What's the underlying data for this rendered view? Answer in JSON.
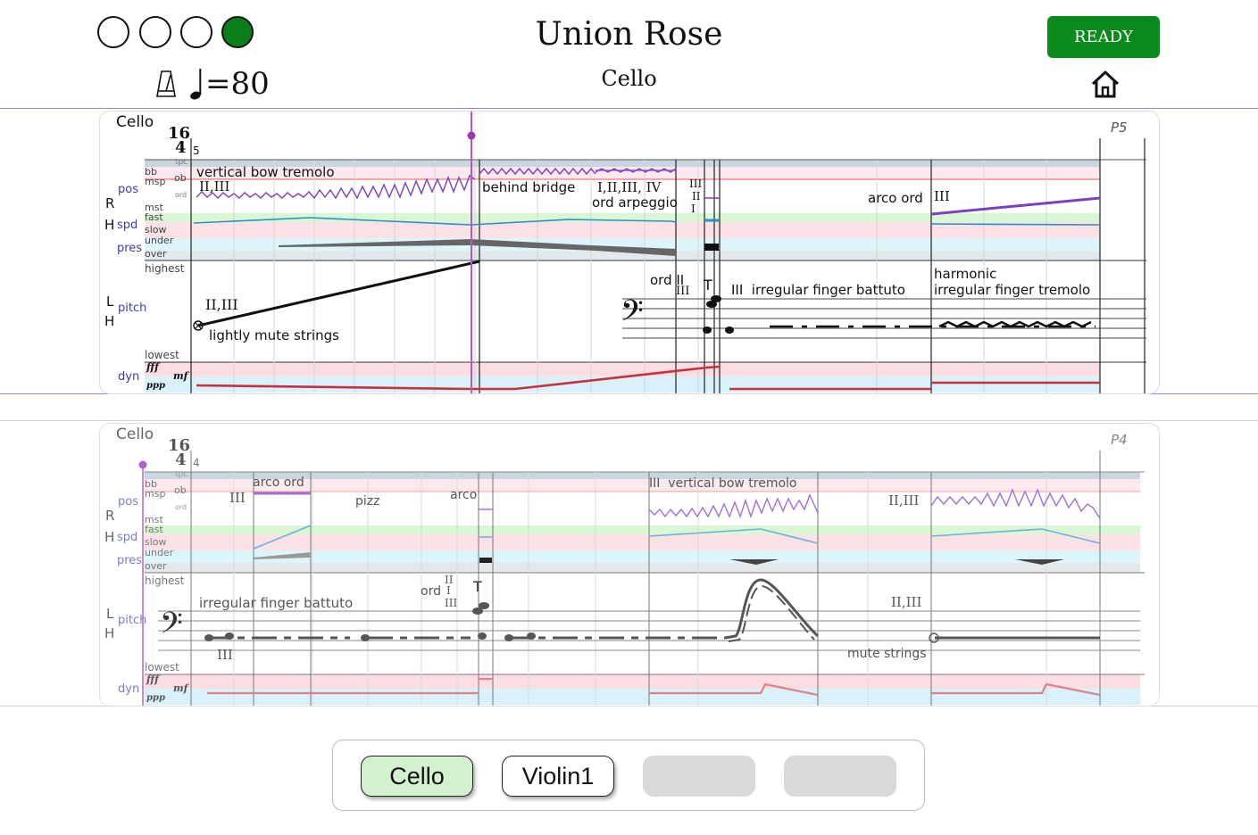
{
  "header": {
    "title": "Union Rose",
    "subtitle": "Cello",
    "ready_label": "READY",
    "tempo_text": "=80",
    "indicators": [
      false,
      false,
      false,
      true
    ],
    "accent_green": "#0a8a1d",
    "home_icon": "home-icon",
    "metronome_icon": "metronome-icon"
  },
  "score_top": {
    "instrument": "Cello",
    "page_marker": "P5",
    "time_sig_top": "16",
    "time_sig_bottom": "4",
    "measure_number": "5",
    "row_labels": {
      "pos": "pos",
      "spd": "spd",
      "pres": "pres",
      "pitch": "pitch",
      "dyn": "dyn",
      "R": "R",
      "H": "H",
      "L": "L"
    },
    "sub_labels": {
      "bb": "bb",
      "msp": "msp",
      "mst": "mst",
      "tpc": "tpc",
      "ob": "ob",
      "ord": "ord",
      "fast": "fast",
      "slow": "slow",
      "under": "under",
      "over": "over",
      "highest": "highest",
      "lowest": "lowest",
      "fff": "fff",
      "mf": "mf",
      "ppp": "ppp"
    },
    "annotations": {
      "vertical_bow_tremolo": "vertical bow tremolo",
      "strings_a": "II,III",
      "behind_bridge": "behind bridge",
      "strings_b": "I,II,III, IV",
      "ord_arpeggio": "ord arpeggio",
      "strings_c": "III",
      "strings_c2": "II",
      "strings_c3": "I",
      "arco_ord": "arco ord",
      "strings_d": "III",
      "strings_e": "II,III",
      "lightly_mute": "lightly mute strings",
      "ord_ii": "ord II",
      "ord_iii": "III",
      "irregular_battuto": "III  irregular finger battuto",
      "harmonic": "harmonic",
      "irregular_tremolo": "irregular finger tremolo"
    }
  },
  "score_bottom": {
    "instrument": "Cello",
    "page_marker": "P4",
    "time_sig_top": "16",
    "time_sig_bottom": "4",
    "measure_number": "4",
    "row_labels": {
      "pos": "pos",
      "spd": "spd",
      "pres": "pres",
      "pitch": "pitch",
      "dyn": "dyn",
      "R": "R",
      "H": "H",
      "L": "L"
    },
    "sub_labels": {
      "bb": "bb",
      "msp": "msp",
      "mst": "mst",
      "tpc": "tpc",
      "ob": "ob",
      "ord": "ord",
      "fast": "fast",
      "slow": "slow",
      "under": "under",
      "over": "over",
      "highest": "highest",
      "lowest": "lowest",
      "fff": "fff",
      "mf": "mf",
      "ppp": "ppp"
    },
    "annotations": {
      "strings_a": "III",
      "arco_ord": "arco ord",
      "pizz": "pizz",
      "arco": "arco",
      "vertical_bow_tremolo": "III  vertical bow tremolo",
      "strings_b": "II,III",
      "irregular_battuto": "irregular finger battuto",
      "ord": "ord",
      "ord_ii": "II",
      "ord_i": "I",
      "ord_iii": "III",
      "strings_c": "III",
      "strings_d": "II,III",
      "mute_strings": "mute strings"
    }
  },
  "instrument_tabs": [
    {
      "label": "Cello",
      "active": true
    },
    {
      "label": "Violin1",
      "active": false
    },
    {
      "label": "",
      "active": false
    },
    {
      "label": "",
      "active": false
    }
  ]
}
